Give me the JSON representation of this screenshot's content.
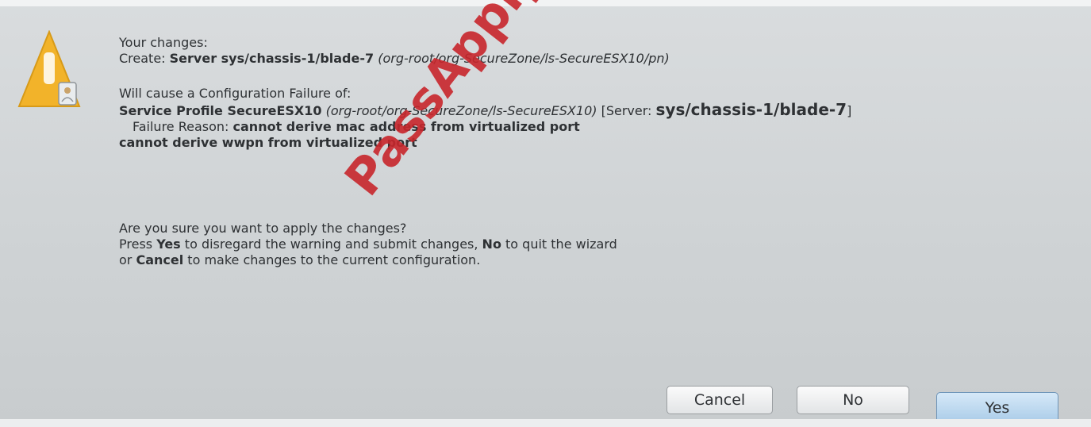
{
  "dialog": {
    "changes_heading": "Your changes:",
    "create_line": {
      "prefix": "Create: ",
      "bold": "Server sys/chassis-1/blade-7",
      "italic": "(org-root/org-SecureZone/ls-SecureESX10/pn)"
    },
    "will_cause": "Will cause a Configuration Failure of:",
    "failure_line": {
      "bold": "Service Profile SecureESX10",
      "italic": "(org-root/org-SecureZone/ls-SecureESX10)",
      "server_prefix": "[Server: ",
      "server_bold": "sys/chassis-1/blade-7",
      "server_suffix": "]"
    },
    "reason_line": {
      "prefix": "Failure Reason: ",
      "bold": "cannot derive mac address from virtualized port"
    },
    "reason_line2": "cannot derive wwpn from virtualized port",
    "question": "Are you sure you want to apply the changes?",
    "instruction1": {
      "p1": "Press ",
      "yes": "Yes",
      "p2": " to disregard the warning and submit changes, ",
      "no": "No",
      "p3": " to quit the wizard"
    },
    "instruction2": {
      "p1": "or ",
      "cancel": "Cancel",
      "p2": " to make changes to the current configuration."
    }
  },
  "buttons": {
    "cancel": "Cancel",
    "no": "No",
    "yes": "Yes"
  },
  "watermark": "PassApply.com",
  "icons": {
    "warning": "warning-icon"
  },
  "colors": {
    "watermark": "#c8262c",
    "warning_yellow": "#f2b32a",
    "default_button": "#a9cbe8"
  }
}
